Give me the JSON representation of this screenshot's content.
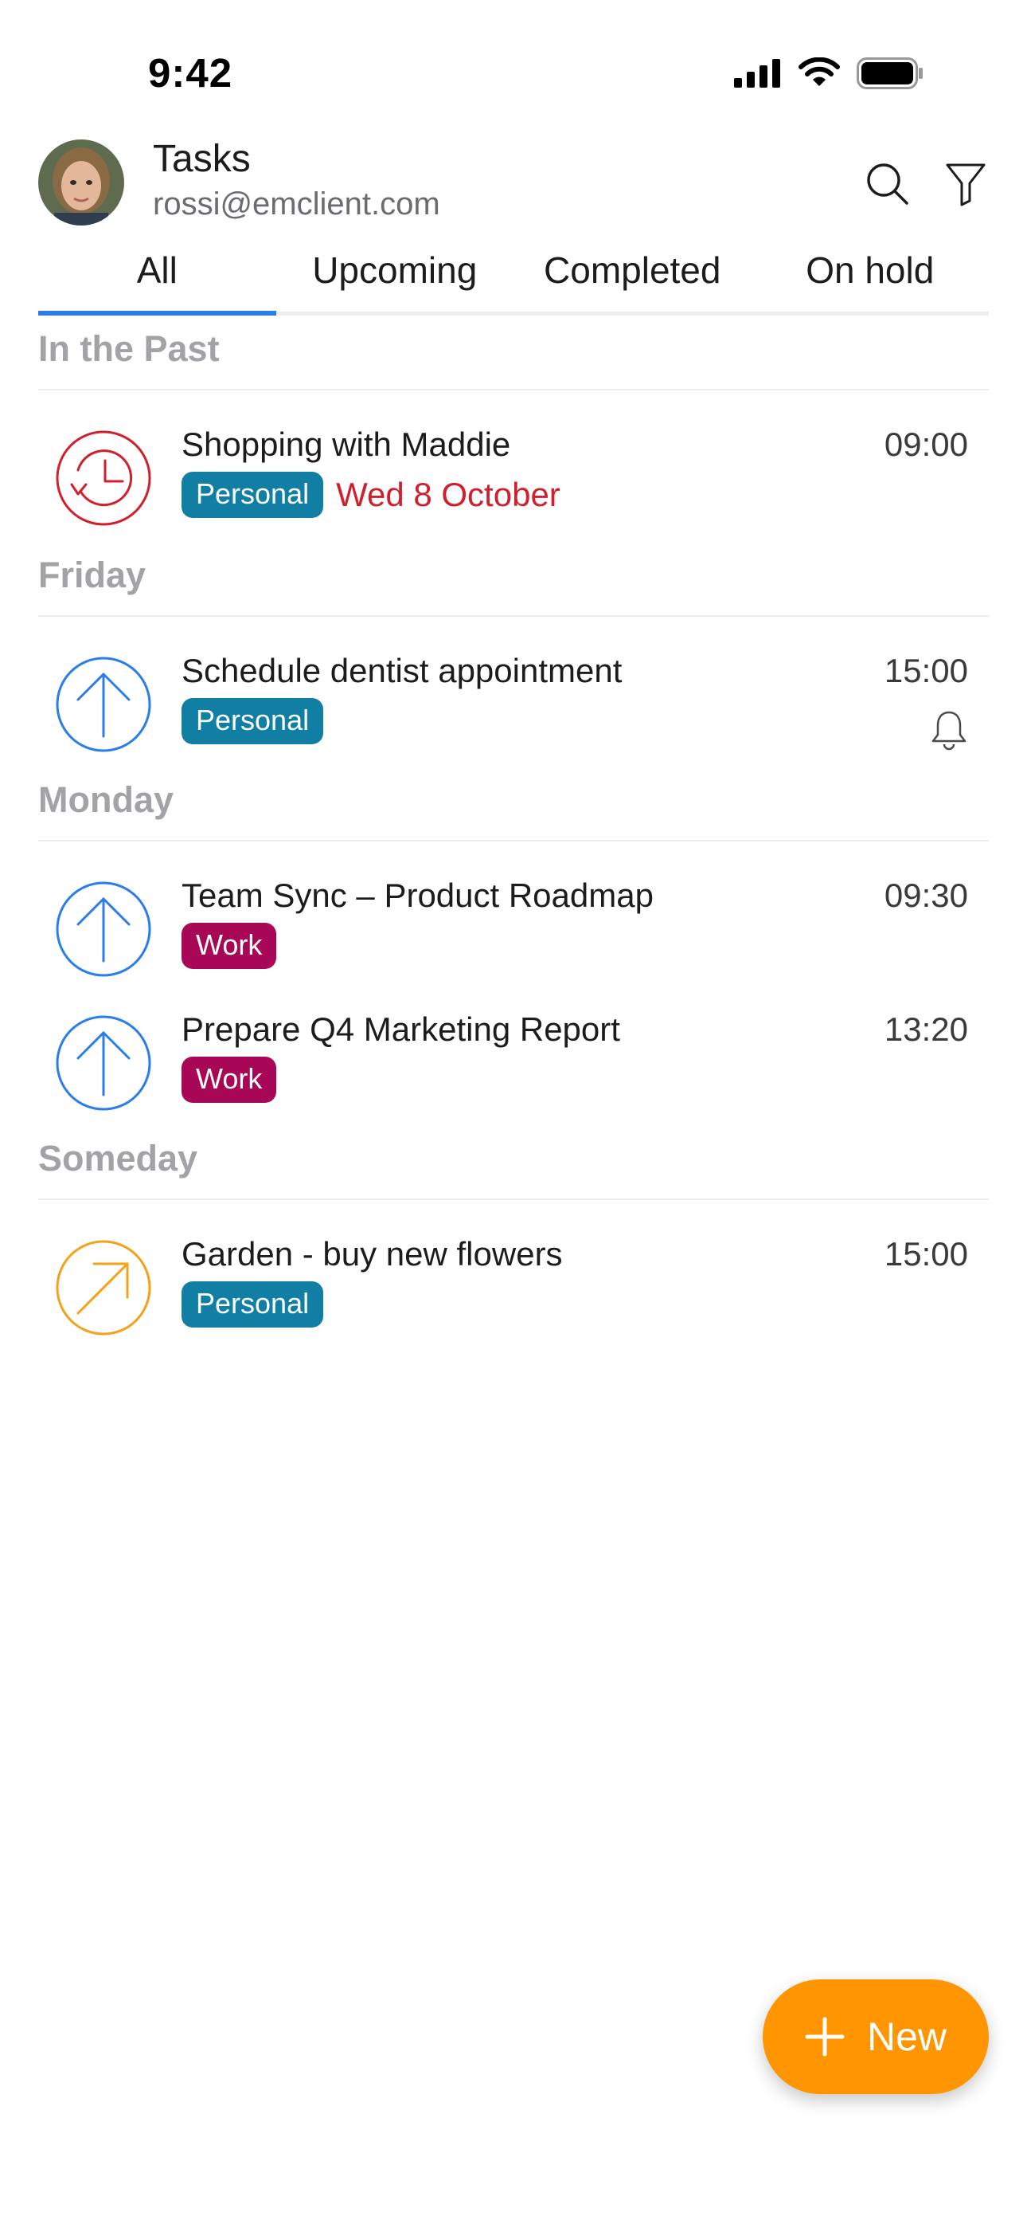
{
  "status_bar": {
    "time": "9:42"
  },
  "header": {
    "title": "Tasks",
    "email": "rossi@emclient.com"
  },
  "tabs": [
    {
      "label": "All",
      "active": true
    },
    {
      "label": "Upcoming",
      "active": false
    },
    {
      "label": "Completed",
      "active": false
    },
    {
      "label": "On hold",
      "active": false
    }
  ],
  "sections": [
    {
      "title": "In the Past",
      "tasks": [
        {
          "title": "Shopping with Maddie",
          "time": "09:00",
          "tag": "Personal",
          "due": "Wed 8 October",
          "icon": "overdue-clock-icon"
        }
      ]
    },
    {
      "title": "Friday",
      "tasks": [
        {
          "title": "Schedule dentist appointment",
          "time": "15:00",
          "tag": "Personal",
          "icon": "priority-up-arrow-icon",
          "reminder": true
        }
      ]
    },
    {
      "title": "Monday",
      "tasks": [
        {
          "title": "Team Sync – Product Roadmap",
          "time": "09:30",
          "tag": "Work",
          "icon": "priority-up-arrow-icon"
        },
        {
          "title": "Prepare Q4 Marketing Report",
          "time": "13:20",
          "tag": "Work",
          "icon": "priority-up-arrow-icon"
        }
      ]
    },
    {
      "title": "Someday",
      "tasks": [
        {
          "title": "Garden - buy new flowers",
          "time": "15:00",
          "tag": "Personal",
          "icon": "diagonal-arrow-icon"
        }
      ]
    }
  ],
  "fab": {
    "label": "New"
  },
  "colors": {
    "accent_blue": "#2b7de9",
    "overdue_red": "#d0202d",
    "personal_tag": "#117fa4",
    "work_tag": "#a70754",
    "someday_orange": "#f5a21b",
    "fab_orange": "#ff9500"
  }
}
